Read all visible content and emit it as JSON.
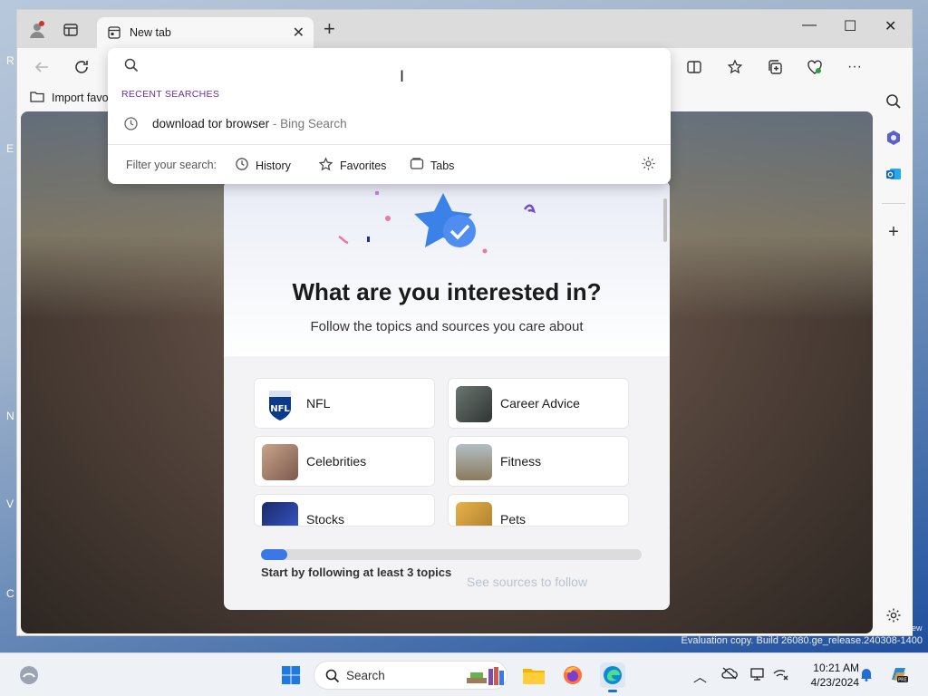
{
  "desktop": {
    "edge_letters": [
      "R",
      "E",
      "N",
      "V",
      "C"
    ],
    "evaluation_text": "Evaluation copy. Build 26080.ge_release.240308-1400",
    "watermark_word": "ew"
  },
  "browser": {
    "tab_title": "New tab",
    "favorites_bar": {
      "import_label": "Import favo"
    },
    "address_bar": {
      "value": "",
      "placeholder": ""
    }
  },
  "dropdown": {
    "section_title": "RECENT SEARCHES",
    "recent_items": [
      {
        "query": "download tor browser",
        "source": " - Bing Search"
      }
    ],
    "filter_label": "Filter your search:",
    "filters": [
      {
        "label": "History"
      },
      {
        "label": "Favorites"
      },
      {
        "label": "Tabs"
      }
    ]
  },
  "interests": {
    "heading": "What are you interested in?",
    "subheading": "Follow the topics and sources you care about",
    "topics": [
      {
        "label": "NFL",
        "thumb": "nfl-logo"
      },
      {
        "label": "Career Advice",
        "thumb": "career-photo"
      },
      {
        "label": "Celebrities",
        "thumb": "celebrities-photo"
      },
      {
        "label": "Fitness",
        "thumb": "fitness-photo"
      },
      {
        "label": "Stocks",
        "thumb": "stocks-photo"
      },
      {
        "label": "Pets",
        "thumb": "pets-photo"
      }
    ],
    "progress_fraction": 0.07,
    "progress_text": "Start by following at least 3 topics",
    "sources_link": "See sources to follow"
  },
  "taskbar": {
    "search_label": "Search",
    "time": "10:21 AM",
    "date": "4/23/2024"
  },
  "colors": {
    "accent": "#3b78e7",
    "section_purple": "#6b2fa3"
  }
}
